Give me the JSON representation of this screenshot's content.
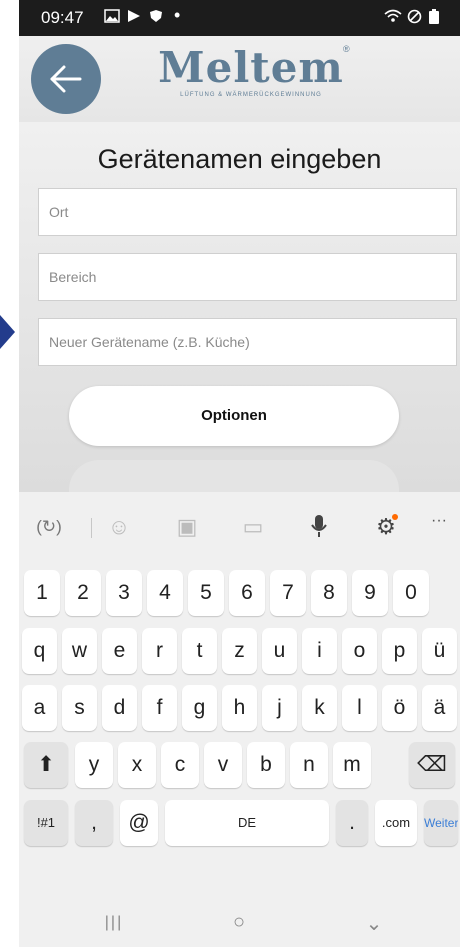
{
  "status_bar": {
    "time": "09:47",
    "left_icons": [
      "image-icon",
      "play-store-icon",
      "shield-icon",
      "dot-icon"
    ],
    "right_icons": [
      "wifi-icon",
      "no-disturb-icon",
      "battery-icon"
    ]
  },
  "header": {
    "logo_text": "Meltem",
    "logo_subtitle": "LÜFTUNG & WÄRMERÜCKGEWINNUNG",
    "logo_mark": "®",
    "back_icon": "arrow-left-icon"
  },
  "form": {
    "title": "Gerätenamen eingeben",
    "field_ort_placeholder": "Ort",
    "field_bereich_placeholder": "Bereich",
    "field_name_placeholder": "Neuer Gerätename (z.B. Küche)",
    "options_button": "Optionen"
  },
  "keyboard": {
    "toolbar_icons": [
      "translate-icon",
      "emoji-icon",
      "sticker-icon",
      "gif-icon",
      "mic-icon",
      "settings-icon",
      "more-icon"
    ],
    "rows": [
      [
        "1",
        "2",
        "3",
        "4",
        "5",
        "6",
        "7",
        "8",
        "9",
        "0"
      ],
      [
        "q",
        "w",
        "e",
        "r",
        "t",
        "z",
        "u",
        "i",
        "o",
        "p",
        "ü"
      ],
      [
        "a",
        "s",
        "d",
        "f",
        "g",
        "h",
        "j",
        "k",
        "l",
        "ö",
        "ä"
      ],
      [
        "y",
        "x",
        "c",
        "v",
        "b",
        "n",
        "m"
      ]
    ],
    "shift_key": "⬆",
    "backspace_key": "⌫",
    "symbols_key": "!#1",
    "comma_key": ",",
    "at_key": "@",
    "space_key": "DE",
    "period_key": ".",
    "dotcom_key": ".com",
    "enter_key": "Weiter"
  },
  "nav_bar": {
    "recents": "|||",
    "home": "○",
    "back": "⌄"
  },
  "colors": {
    "brand": "#5f7d95",
    "edge_marker": "#233c8c",
    "key_accent": "#3b7ed6"
  }
}
